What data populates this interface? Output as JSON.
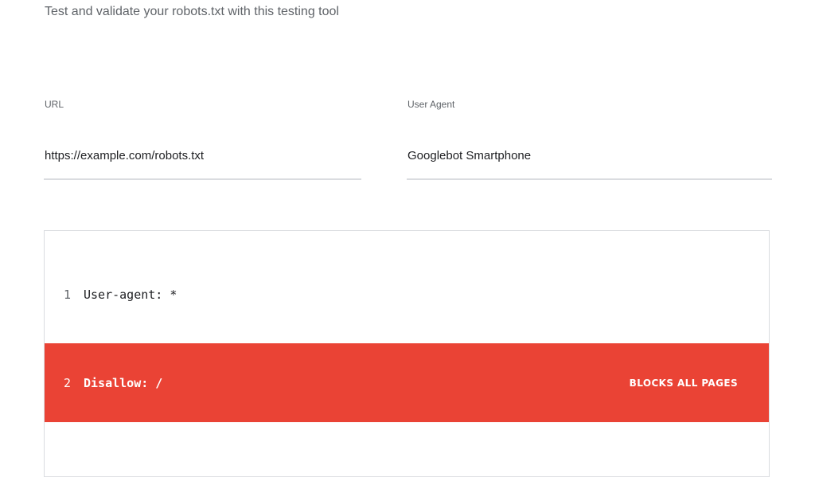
{
  "header": {
    "subtitle": "Test and validate your robots.txt with this testing tool"
  },
  "form": {
    "url": {
      "label": "URL",
      "value": "https://example.com/robots.txt"
    },
    "user_agent": {
      "label": "User Agent",
      "value": "Googlebot Smartphone"
    }
  },
  "editor": {
    "lines": [
      {
        "number": "1",
        "text": "User-agent: *"
      },
      {
        "number": "2",
        "text": "Disallow: /",
        "status": "BLOCKS ALL PAGES",
        "highlight_color": "#ea4335"
      }
    ]
  },
  "colors": {
    "error": "#ea4335",
    "divider": "#dadce0",
    "muted_text": "#5f6368"
  }
}
